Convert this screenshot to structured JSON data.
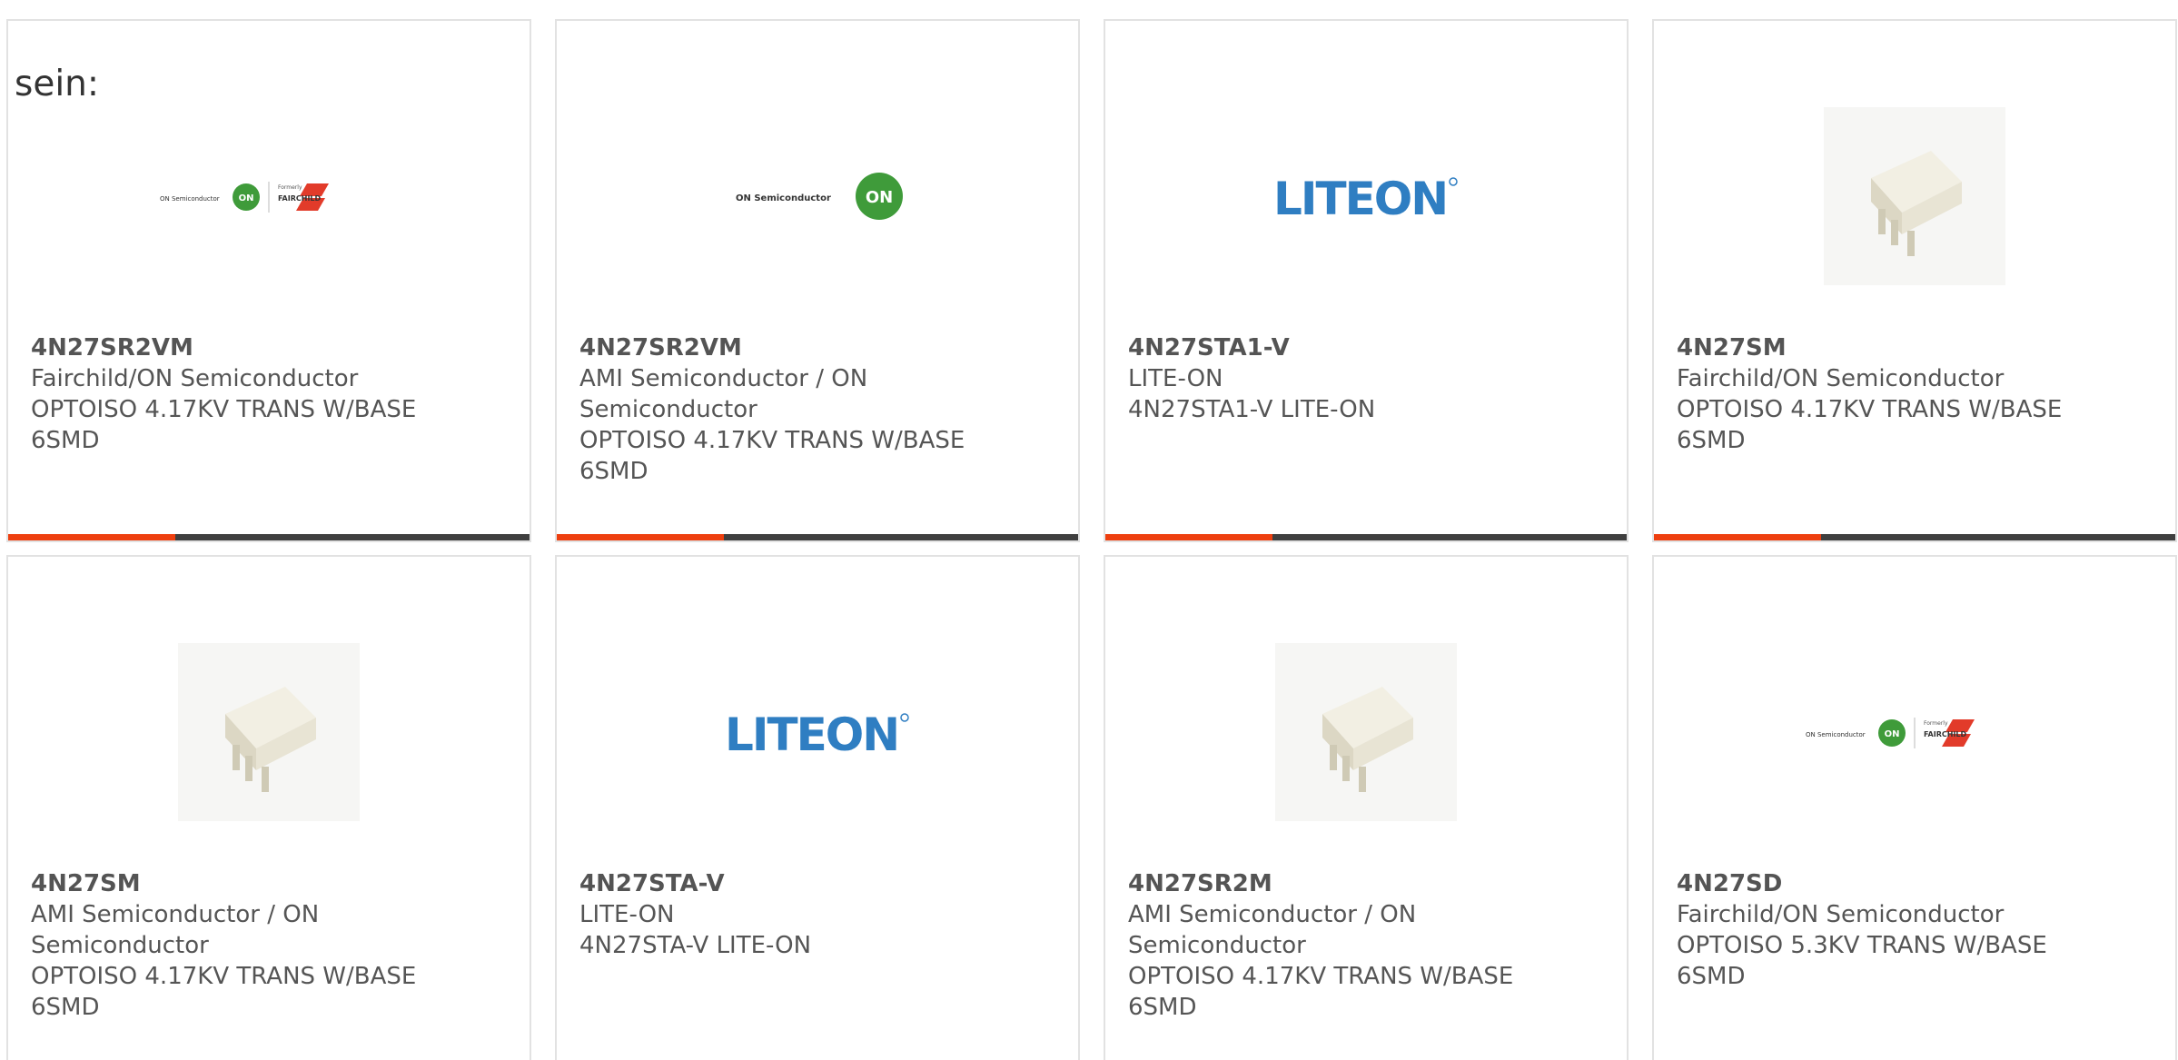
{
  "intro_text": "sein:",
  "colors": {
    "accent_bar": "#ee3f0f",
    "dark_bar": "#3f3f3f",
    "on_green": "#3f9b3a",
    "liteon_blue": "#2f7ec2",
    "fairchild_red": "#e23b2a"
  },
  "logos": {
    "on_semi_text": "ON Semiconductor",
    "on_badge": "ON",
    "formerly": "Formerly",
    "fairchild": "FAIRCHILD",
    "liteon": "LITEON"
  },
  "products": [
    {
      "image": "on-fairchild-logo",
      "part_number": "4N27SR2VM",
      "manufacturer": [
        "Fairchild/ON Semiconductor"
      ],
      "description": [
        "OPTOISO 4.17KV TRANS W/BASE",
        "6SMD"
      ]
    },
    {
      "image": "on-semiconductor-logo",
      "part_number": "4N27SR2VM",
      "manufacturer": [
        "AMI Semiconductor / ON",
        "Semiconductor"
      ],
      "description": [
        "OPTOISO 4.17KV TRANS W/BASE",
        "6SMD"
      ]
    },
    {
      "image": "liteon-logo",
      "part_number": "4N27STA1-V",
      "manufacturer": [
        "LITE-ON"
      ],
      "description": [
        "4N27STA1-V LITE-ON"
      ]
    },
    {
      "image": "smd-chip-photo",
      "part_number": "4N27SM",
      "manufacturer": [
        "Fairchild/ON Semiconductor"
      ],
      "description": [
        "OPTOISO 4.17KV TRANS W/BASE",
        "6SMD"
      ]
    },
    {
      "image": "smd-chip-photo",
      "part_number": "4N27SM",
      "manufacturer": [
        "AMI Semiconductor / ON",
        "Semiconductor"
      ],
      "description": [
        "OPTOISO 4.17KV TRANS W/BASE",
        "6SMD"
      ]
    },
    {
      "image": "liteon-logo",
      "part_number": "4N27STA-V",
      "manufacturer": [
        "LITE-ON"
      ],
      "description": [
        "4N27STA-V LITE-ON"
      ]
    },
    {
      "image": "smd-chip-photo",
      "part_number": "4N27SR2M",
      "manufacturer": [
        "AMI Semiconductor / ON",
        "Semiconductor"
      ],
      "description": [
        "OPTOISO 4.17KV TRANS W/BASE",
        "6SMD"
      ]
    },
    {
      "image": "on-fairchild-logo",
      "part_number": "4N27SD",
      "manufacturer": [
        "Fairchild/ON Semiconductor"
      ],
      "description": [
        "OPTOISO 5.3KV TRANS W/BASE",
        "6SMD"
      ]
    }
  ]
}
